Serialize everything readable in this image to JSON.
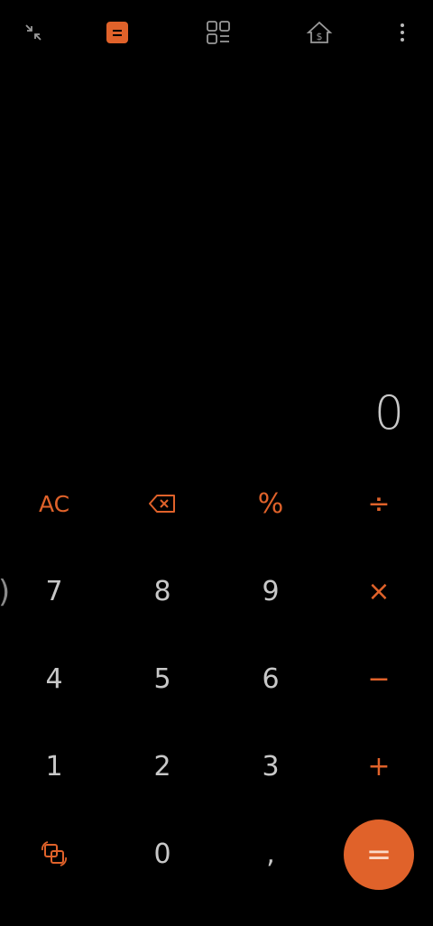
{
  "toolbar": {
    "icons": [
      "collapse-icon",
      "calculator-mode-icon",
      "converter-grid-icon",
      "currency-icon",
      "more-vert-icon"
    ],
    "accent": "#e0622a"
  },
  "display": {
    "value": "0"
  },
  "keys": {
    "ac": "AC",
    "percent": "%",
    "divide": "÷",
    "seven": "7",
    "eight": "8",
    "nine": "9",
    "multiply": "×",
    "four": "4",
    "five": "5",
    "six": "6",
    "minus": "−",
    "one": "1",
    "two": "2",
    "three": "3",
    "plus": "+",
    "zero": "0",
    "comma": ",",
    "equals": "="
  },
  "edge": {
    "paren": ")"
  }
}
